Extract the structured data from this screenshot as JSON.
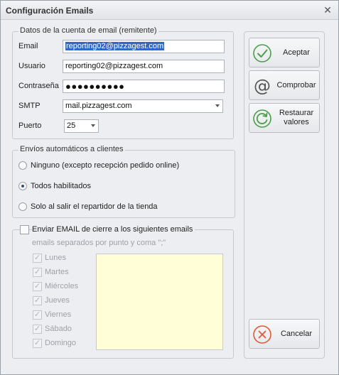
{
  "window": {
    "title": "Configuración Emails",
    "close_glyph": "✕"
  },
  "sender_group": {
    "legend": "Datos de la cuenta de email (remitente)",
    "email_label": "Email",
    "email_value": "reporting02@pizzagest.com",
    "user_label": "Usuario",
    "user_value": "reporting02@pizzagest.com",
    "password_label": "Contraseña",
    "password_value": "●●●●●●●●●●",
    "smtp_label": "SMTP",
    "smtp_value": "mail.pizzagest.com",
    "port_label": "Puerto",
    "port_value": "25"
  },
  "auto_group": {
    "legend": "Envíos automáticos a clientes",
    "options": [
      {
        "label": "Ninguno (excepto recepción pedido online)",
        "selected": false
      },
      {
        "label": "Todos habilitados",
        "selected": true
      },
      {
        "label": "Solo al salir el repartidor de la tienda",
        "selected": false
      }
    ]
  },
  "closing_group": {
    "checkbox_label": "Enviar EMAIL de cierre a los siguientes emails",
    "checked": false,
    "hint": "emails separados por punto y coma \";\"",
    "days": [
      {
        "label": "Lunes",
        "checked": true
      },
      {
        "label": "Martes",
        "checked": true
      },
      {
        "label": "Miércoles",
        "checked": true
      },
      {
        "label": "Jueves",
        "checked": true
      },
      {
        "label": "Viernes",
        "checked": true
      },
      {
        "label": "Sábado",
        "checked": true
      },
      {
        "label": "Domingo",
        "checked": true
      }
    ],
    "emails_value": "",
    "box_color": "#fffed6"
  },
  "buttons": {
    "accept": {
      "label": "Aceptar",
      "icon": "check-circle-icon",
      "color": "#4aa04a"
    },
    "test": {
      "label": "Comprobar",
      "icon": "at-sign-icon"
    },
    "restore": {
      "label": "Restaurar valores",
      "icon": "refresh-circle-icon",
      "color": "#4aa04a"
    },
    "cancel": {
      "label": "Cancelar",
      "icon": "x-circle-icon",
      "color": "#e05a3a"
    }
  }
}
